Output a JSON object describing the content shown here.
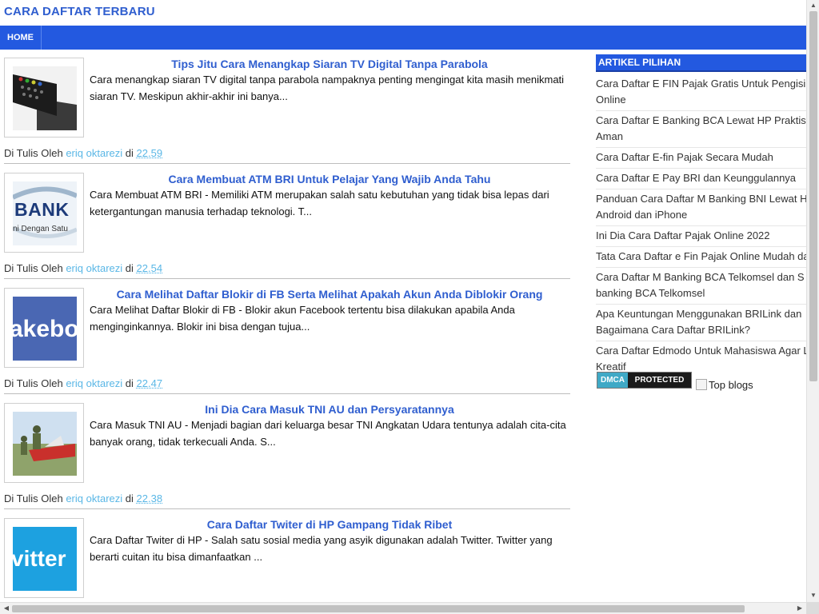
{
  "site": {
    "title": "CARA DAFTAR TERBARU"
  },
  "nav": {
    "home_label": "HOME"
  },
  "posts": [
    {
      "title": "Tips Jitu Cara Menangkap Siaran TV Digital Tanpa Parabola",
      "snippet": "Cara menangkap siaran TV digital tanpa parabola nampaknya penting mengingat kita masih menikmati siaran TV. Meskipun akhir-akhir ini banya...",
      "meta_prefix": "Di Tulis Oleh",
      "author": "eriq oktarezi",
      "meta_at": "di",
      "time": "22.59",
      "thumb_label": ""
    },
    {
      "title": "Cara Membuat ATM BRI Untuk Pelajar Yang Wajib Anda Tahu",
      "snippet": "Cara Membuat ATM BRI - Memiliki ATM merupakan salah satu kebutuhan yang tidak bisa lepas dari ketergantungan manusia terhadap teknologi. T...",
      "meta_prefix": "Di Tulis Oleh",
      "author": "eriq oktarezi",
      "meta_at": "di",
      "time": "22.54",
      "thumb_label": "BANK",
      "thumb_sub": "ni Dengan Satu"
    },
    {
      "title": "Cara Melihat Daftar Blokir di FB Serta Melihat Apakah Akun Anda Diblokir Orang",
      "snippet": "Cara Melihat Daftar Blokir di FB - Blokir akun Facebook tertentu bisa dilakukan apabila Anda menginginkannya. Blokir ini bisa dengan tujua...",
      "meta_prefix": "Di Tulis Oleh",
      "author": "eriq oktarezi",
      "meta_at": "di",
      "time": "22.47",
      "thumb_label": "akeboo"
    },
    {
      "title": "Ini Dia Cara Masuk TNI AU dan Persyaratannya",
      "snippet": "Cara Masuk TNI AU - Menjadi bagian dari keluarga besar TNI Angkatan Udara tentunya adalah cita-cita banyak orang, tidak terkecuali Anda. S...",
      "meta_prefix": "Di Tulis Oleh",
      "author": "eriq oktarezi",
      "meta_at": "di",
      "time": "22.38",
      "thumb_label": ""
    },
    {
      "title": "Cara Daftar Twiter di HP Gampang Tidak Ribet",
      "snippet": "Cara Daftar Twiter di HP - Salah satu sosial media yang asyik digunakan adalah Twitter. Twitter yang berarti cuitan itu bisa dimanfaatkan ...",
      "thumb_label": "vitter"
    }
  ],
  "sidebar": {
    "header": "ARTIKEL PILIHAN",
    "items": [
      "Cara Daftar E FIN Pajak Gratis Untuk Pengisi Online",
      "Cara Daftar E Banking BCA Lewat HP Praktis Aman",
      "Cara Daftar E-fin Pajak Secara Mudah",
      "Cara Daftar E Pay BRI dan Keunggulannya",
      "Panduan Cara Daftar M Banking BNI Lewat H Android dan iPhone",
      "Ini Dia Cara Daftar Pajak Online 2022",
      "Tata Cara Daftar e Fin Pajak Online Mudah da",
      "Cara Daftar M Banking BCA Telkomsel dan S banking BCA Telkomsel",
      "Apa Keuntungan Menggunakan BRILink dan Bagaimana Cara Daftar BRILink?",
      "Cara Daftar Edmodo Untuk Mahasiswa Agar L Kreatif"
    ]
  },
  "badges": {
    "dmca_left": "DMCA",
    "dmca_right": "PROTECTED",
    "topblogs_alt": "Top blogs"
  },
  "colors": {
    "accent": "#2359e0",
    "title_link": "#2f5ecf",
    "meta_link": "#5ab7e6"
  }
}
